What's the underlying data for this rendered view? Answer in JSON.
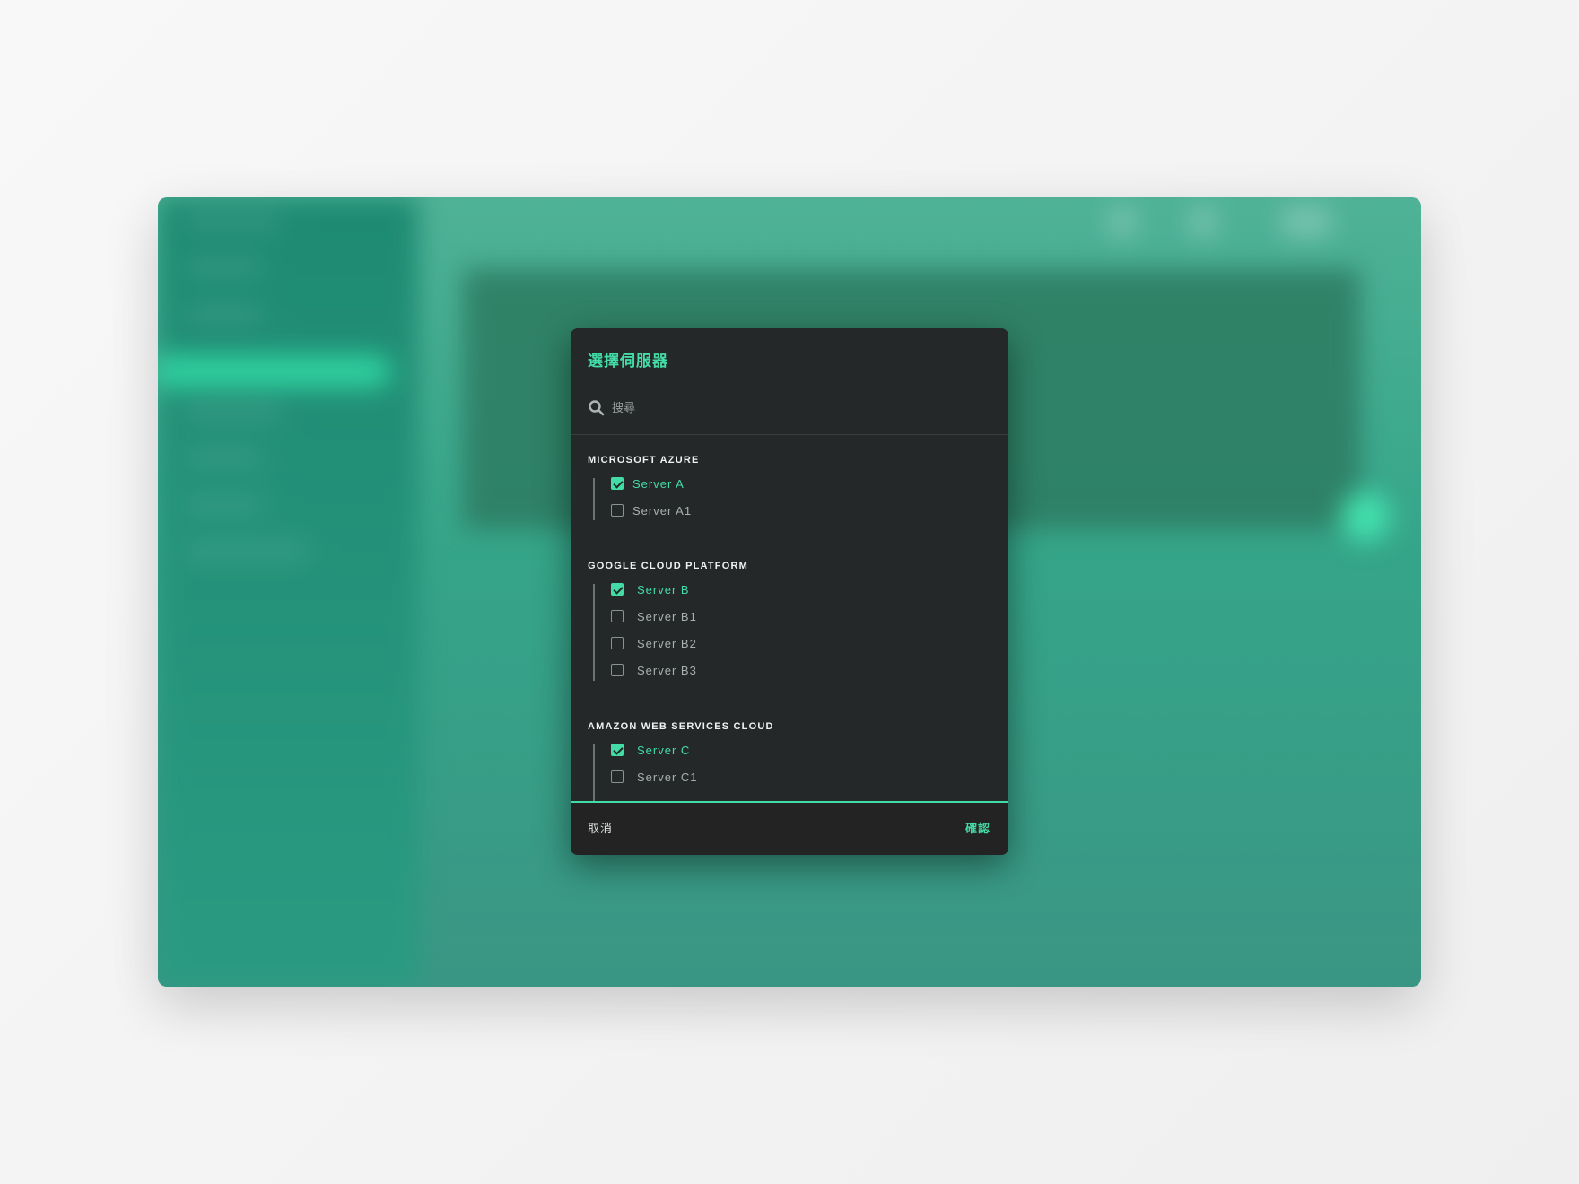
{
  "dialog": {
    "title": "選擇伺服器",
    "search": {
      "placeholder": "搜尋",
      "value": ""
    },
    "groups": [
      {
        "title": "MICROSOFT AZURE",
        "items": [
          {
            "label": "Server A",
            "checked": true
          },
          {
            "label": "Server A1",
            "checked": false
          }
        ]
      },
      {
        "title": "GOOGLE CLOUD PLATFORM",
        "items": [
          {
            "label": "Server B",
            "checked": true
          },
          {
            "label": "Server B1",
            "checked": false
          },
          {
            "label": "Server B2",
            "checked": false
          },
          {
            "label": "Server B3",
            "checked": false
          }
        ]
      },
      {
        "title": "AMAZON WEB SERVICES CLOUD",
        "items": [
          {
            "label": "Server C",
            "checked": true
          },
          {
            "label": "Server C1",
            "checked": false
          }
        ]
      }
    ],
    "cancel_label": "取消",
    "confirm_label": "確認"
  },
  "colors": {
    "accent": "#43dca6",
    "dialog_background": "#242828",
    "backdrop_teal": "#35a589"
  }
}
